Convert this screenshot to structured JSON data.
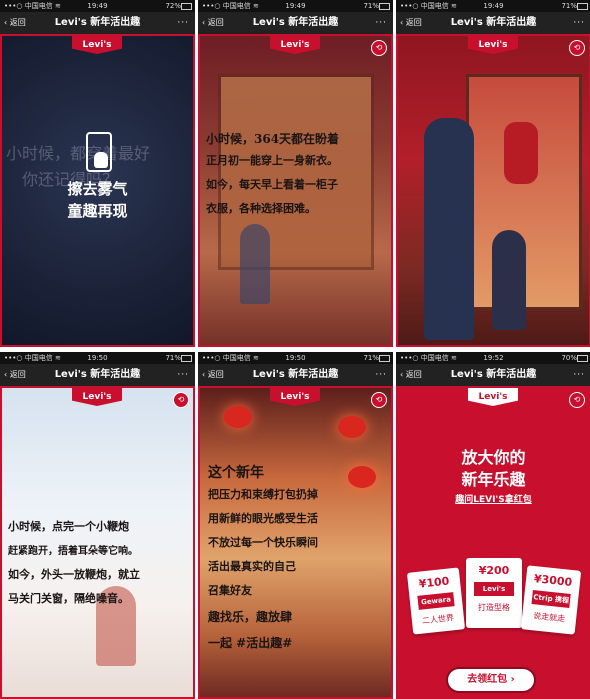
{
  "panels": [
    {
      "status": {
        "carrier": "•••○ 中国电信 ≋",
        "time": "19:49",
        "battery": "72%"
      },
      "nav": {
        "back": "‹ 返回",
        "title": "Levi's 新年活出趣",
        "more": "···"
      },
      "logo": "Levi's",
      "faint_lines": [
        "小时候，都穿着最好",
        "你还记得吗？"
      ],
      "center_lines": [
        "擦去雾气",
        "童趣再现"
      ]
    },
    {
      "status": {
        "carrier": "•••○ 中国电信 ≋",
        "time": "19:49",
        "battery": "71%"
      },
      "nav": {
        "back": "‹ 返回",
        "title": "Levi's 新年活出趣",
        "more": "···"
      },
      "logo": "Levi's",
      "lines": [
        "小时候，364天都在盼着",
        "正月初一能穿上一身新衣。",
        "如今，每天早上看着一柜子",
        "衣服，各种选择困难。"
      ]
    },
    {
      "status": {
        "carrier": "•••○ 中国电信 ≋",
        "time": "19:49",
        "battery": "71%"
      },
      "nav": {
        "back": "‹ 返回",
        "title": "Levi's 新年活出趣",
        "more": "···"
      },
      "logo": "Levi's"
    },
    {
      "status": {
        "carrier": "•••○ 中国电信 ≋",
        "time": "19:50",
        "battery": "71%"
      },
      "nav": {
        "back": "‹ 返回",
        "title": "Levi's 新年活出趣",
        "more": "···"
      },
      "logo": "Levi's",
      "lines": [
        "小时候，点完一个小鞭炮",
        "赶紧跑开，捂着耳朵等它响。",
        "如今，外头一放鞭炮，就立",
        "马关门关窗，隔绝噪音。"
      ]
    },
    {
      "status": {
        "carrier": "•••○ 中国电信 ≋",
        "time": "19:50",
        "battery": "71%"
      },
      "nav": {
        "back": "‹ 返回",
        "title": "Levi's 新年活出趣",
        "more": "···"
      },
      "logo": "Levi's",
      "lines": [
        "这个新年",
        "把压力和束缚打包扔掉",
        "用新鲜的眼光感受生活",
        "不放过每一个快乐瞬间",
        "活出最真实的自己",
        "召集好友",
        "趣找乐，趣放肆",
        "一起 #活出趣#"
      ]
    },
    {
      "status": {
        "carrier": "•••○ 中国电信 ≋",
        "time": "19:52",
        "battery": "70%"
      },
      "nav": {
        "back": "‹ 返回",
        "title": "Levi's 新年活出趣",
        "more": "···"
      },
      "logo": "Levi's",
      "headline": [
        "放大你的",
        "新年乐趣"
      ],
      "subline": "趣问LEVI'S拿红包",
      "envelopes": [
        {
          "amount": "¥100",
          "brand": "Gewara",
          "desc": "二人世界"
        },
        {
          "amount": "¥200",
          "brand": "Levi's",
          "desc": "打造型格"
        },
        {
          "amount": "¥3000",
          "brand": "Ctrip 携程",
          "desc": "说走就走"
        }
      ],
      "button": "去领红包 ›"
    }
  ]
}
